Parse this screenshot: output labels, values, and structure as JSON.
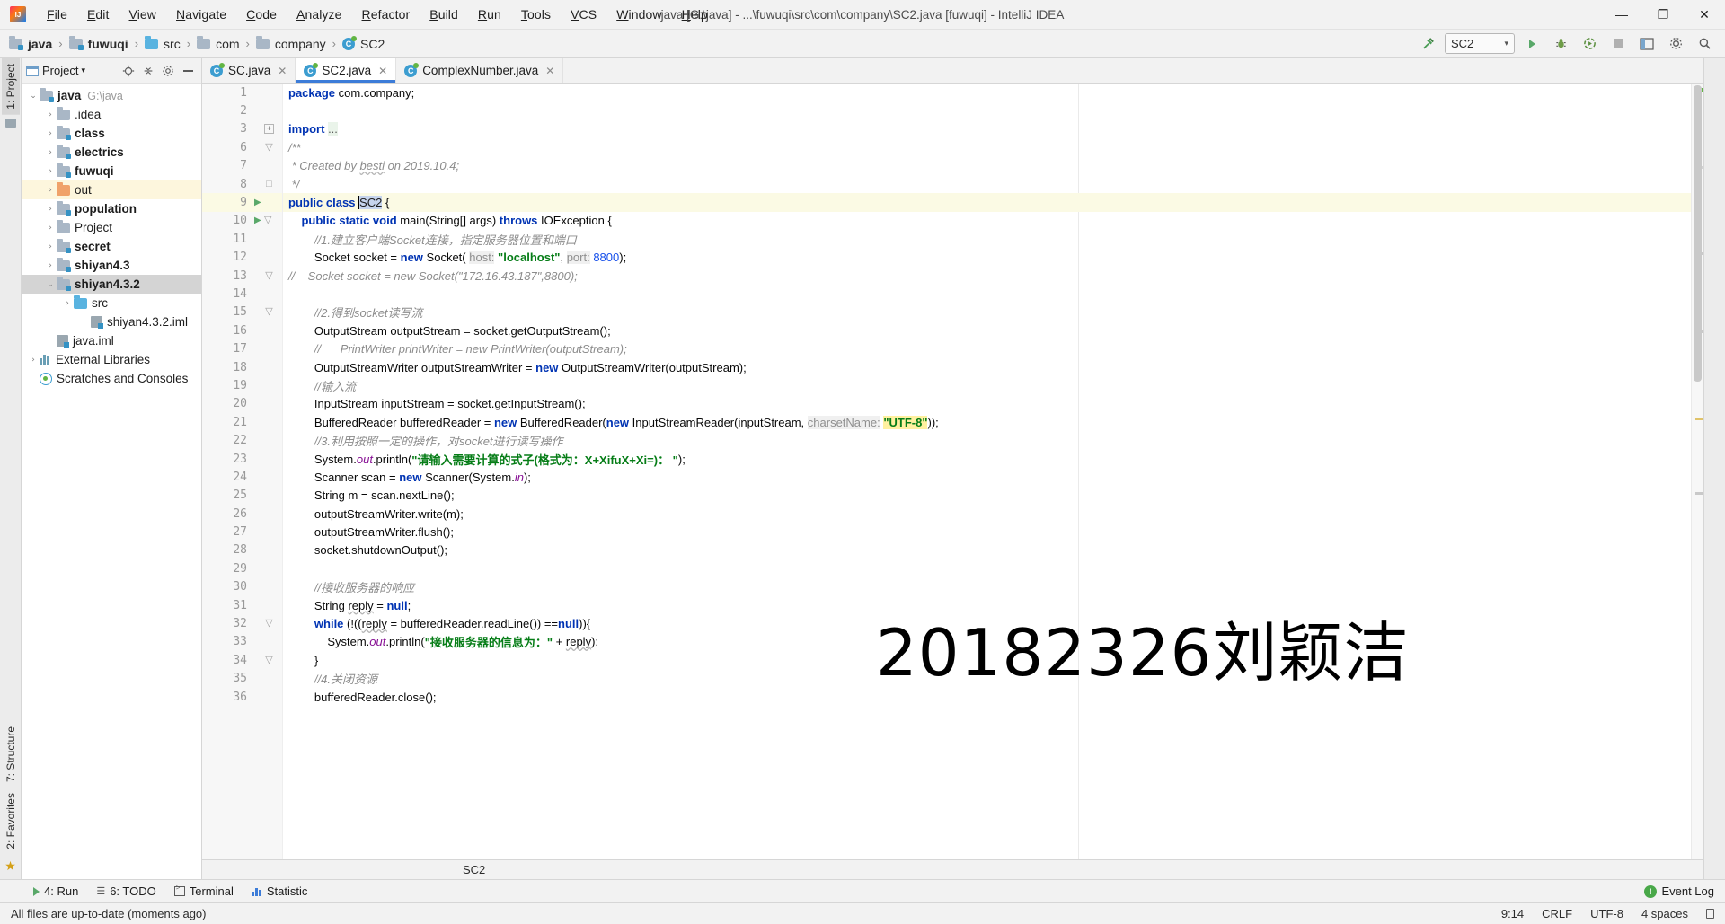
{
  "window": {
    "title": "java [G:\\java] - ...\\fuwuqi\\src\\com\\company\\SC2.java [fuwuqi] - IntelliJ IDEA",
    "minimize": "—",
    "maximize": "❐",
    "close": "✕"
  },
  "menu": {
    "items": [
      "File",
      "Edit",
      "View",
      "Navigate",
      "Code",
      "Analyze",
      "Refactor",
      "Build",
      "Run",
      "Tools",
      "VCS",
      "Window",
      "Help"
    ]
  },
  "breadcrumb": {
    "separator": "›",
    "items": [
      {
        "label": "java",
        "icon": "folder-module-icon",
        "bold": true
      },
      {
        "label": "fuwuqi",
        "icon": "folder-module-icon",
        "bold": true
      },
      {
        "label": "src",
        "icon": "folder-source-icon",
        "bold": false
      },
      {
        "label": "com",
        "icon": "folder-package-icon",
        "bold": false
      },
      {
        "label": "company",
        "icon": "folder-package-icon",
        "bold": false
      },
      {
        "label": "SC2",
        "icon": "java-class-icon",
        "bold": false
      }
    ]
  },
  "toolbar": {
    "build_icon": "hammer-icon",
    "run_config": "SC2",
    "run_config_caret": "▾",
    "run_icon": "▶",
    "debug_icon": "bug-icon",
    "coverage_icon": "run-coverage-icon",
    "stop_icon": "■",
    "layout_icon": "ide-layout-icon",
    "settings_icon": "⚙",
    "search_icon": "⚲"
  },
  "project_panel": {
    "title": "Project",
    "title_caret": "▾",
    "actions": [
      {
        "name": "locate-icon",
        "glyph": "⊕"
      },
      {
        "name": "collapse-all-icon",
        "glyph": "≃"
      },
      {
        "name": "settings-gear-icon",
        "glyph": "⚙"
      },
      {
        "name": "hide-panel-icon",
        "glyph": "—"
      }
    ],
    "tree": [
      {
        "label": "java",
        "sub": "G:\\java",
        "indent": 0,
        "twisty": "⌄",
        "icon": "folder-module-icon",
        "bold": true,
        "state": "expanded"
      },
      {
        "label": ".idea",
        "sub": "",
        "indent": 1,
        "twisty": "›",
        "icon": "folder-plain-icon",
        "bold": false,
        "state": "collapsed"
      },
      {
        "label": "class",
        "sub": "",
        "indent": 1,
        "twisty": "›",
        "icon": "folder-module-icon",
        "bold": true,
        "state": "collapsed"
      },
      {
        "label": "electrics",
        "sub": "",
        "indent": 1,
        "twisty": "›",
        "icon": "folder-module-icon",
        "bold": true,
        "state": "collapsed"
      },
      {
        "label": "fuwuqi",
        "sub": "",
        "indent": 1,
        "twisty": "›",
        "icon": "folder-module-icon",
        "bold": true,
        "state": "collapsed"
      },
      {
        "label": "out",
        "sub": "",
        "indent": 1,
        "twisty": "›",
        "icon": "folder-excluded-icon",
        "bold": false,
        "state": "collapsed",
        "row": "highlight"
      },
      {
        "label": "population",
        "sub": "",
        "indent": 1,
        "twisty": "›",
        "icon": "folder-module-icon",
        "bold": true,
        "state": "collapsed"
      },
      {
        "label": "Project",
        "sub": "",
        "indent": 1,
        "twisty": "›",
        "icon": "folder-plain-icon",
        "bold": false,
        "state": "collapsed"
      },
      {
        "label": "secret",
        "sub": "",
        "indent": 1,
        "twisty": "›",
        "icon": "folder-module-icon",
        "bold": true,
        "state": "collapsed"
      },
      {
        "label": "shiyan4.3",
        "sub": "",
        "indent": 1,
        "twisty": "›",
        "icon": "folder-module-icon",
        "bold": true,
        "state": "collapsed"
      },
      {
        "label": "shiyan4.3.2",
        "sub": "",
        "indent": 1,
        "twisty": "⌄",
        "icon": "folder-module-icon",
        "bold": true,
        "state": "expanded",
        "row": "selected"
      },
      {
        "label": "src",
        "sub": "",
        "indent": 2,
        "twisty": "›",
        "icon": "folder-source-icon",
        "bold": false,
        "state": "collapsed"
      },
      {
        "label": "shiyan4.3.2.iml",
        "sub": "",
        "indent": 3,
        "twisty": "",
        "icon": "iml-file-icon",
        "bold": false,
        "state": "leaf"
      },
      {
        "label": "java.iml",
        "sub": "",
        "indent": 1,
        "twisty": "",
        "icon": "iml-file-icon",
        "bold": false,
        "state": "leaf"
      },
      {
        "label": "External Libraries",
        "sub": "",
        "indent": 0,
        "twisty": "›",
        "icon": "libraries-icon",
        "bold": false,
        "state": "collapsed"
      },
      {
        "label": "Scratches and Consoles",
        "sub": "",
        "indent": 0,
        "twisty": "",
        "icon": "scratches-icon",
        "bold": false,
        "state": "leaf"
      }
    ]
  },
  "left_rail": {
    "tabs": [
      {
        "label": "1: Project",
        "active": true
      },
      {
        "label": "7: Structure",
        "active": false
      },
      {
        "label": "2: Favorites",
        "active": false
      }
    ]
  },
  "editor_tabs": [
    {
      "label": "SC.java",
      "icon": "java-class-icon",
      "active": false,
      "close": "✕"
    },
    {
      "label": "SC2.java",
      "icon": "java-class-icon",
      "active": true,
      "close": "✕"
    },
    {
      "label": "ComplexNumber.java",
      "icon": "java-class-icon",
      "active": false,
      "close": "✕"
    }
  ],
  "editor": {
    "watermark": "20182326刘颖洁",
    "caret_line": 9,
    "lines": [
      {
        "num": "1",
        "runmark": false,
        "fold": "",
        "tokens": [
          {
            "t": "package ",
            "c": "kw"
          },
          {
            "t": "com.company;",
            "c": "txt"
          }
        ]
      },
      {
        "num": "2",
        "runmark": false,
        "fold": "",
        "tokens": []
      },
      {
        "num": "3",
        "runmark": false,
        "fold": "plus",
        "tokens": [
          {
            "t": "import ",
            "c": "kw"
          },
          {
            "t": "...",
            "c": "fold-imports"
          }
        ]
      },
      {
        "num": "6",
        "runmark": false,
        "fold": "minus",
        "tokens": [
          {
            "t": "/**",
            "c": "cmt"
          }
        ]
      },
      {
        "num": "7",
        "runmark": false,
        "fold": "",
        "tokens": [
          {
            "t": " * Created by ",
            "c": "cmt"
          },
          {
            "t": "besti",
            "c": "cmt-ul"
          },
          {
            "t": " on 2019.10.4;",
            "c": "cmt"
          }
        ]
      },
      {
        "num": "8",
        "runmark": false,
        "fold": "end",
        "tokens": [
          {
            "t": " */",
            "c": "cmt"
          }
        ]
      },
      {
        "num": "9",
        "runmark": true,
        "fold": "",
        "tokens": [
          {
            "t": "public class ",
            "c": "kw"
          },
          {
            "t": "|",
            "c": "caret"
          },
          {
            "t": "SC2",
            "c": "sel"
          },
          {
            "t": " {",
            "c": "txt"
          }
        ]
      },
      {
        "num": "10",
        "runmark": true,
        "fold": "minus",
        "tokens": [
          {
            "t": "    ",
            "c": "txt"
          },
          {
            "t": "public static void ",
            "c": "kw"
          },
          {
            "t": "main(String[] args) ",
            "c": "txt"
          },
          {
            "t": "throws ",
            "c": "kw"
          },
          {
            "t": "IOException {",
            "c": "txt"
          }
        ]
      },
      {
        "num": "11",
        "runmark": false,
        "fold": "",
        "tokens": [
          {
            "t": "        //1.建立客户端Socket连接，指定服务器位置和端口",
            "c": "cmt"
          }
        ]
      },
      {
        "num": "12",
        "runmark": false,
        "fold": "",
        "tokens": [
          {
            "t": "        Socket socket = ",
            "c": "txt"
          },
          {
            "t": "new ",
            "c": "kw"
          },
          {
            "t": "Socket( ",
            "c": "txt"
          },
          {
            "t": "host:",
            "c": "hint"
          },
          {
            "t": " ",
            "c": "txt"
          },
          {
            "t": "\"localhost\"",
            "c": "str"
          },
          {
            "t": ", ",
            "c": "txt"
          },
          {
            "t": "port:",
            "c": "hint"
          },
          {
            "t": " ",
            "c": "txt"
          },
          {
            "t": "8800",
            "c": "num"
          },
          {
            "t": ");",
            "c": "txt"
          }
        ]
      },
      {
        "num": "13",
        "runmark": false,
        "fold": "minus",
        "tokens": [
          {
            "t": "//    Socket socket = new Socket(\"172.16.43.187\",8800);",
            "c": "cmt"
          }
        ]
      },
      {
        "num": "14",
        "runmark": false,
        "fold": "",
        "tokens": []
      },
      {
        "num": "15",
        "runmark": false,
        "fold": "minus",
        "tokens": [
          {
            "t": "        //2.得到socket读写流",
            "c": "cmt"
          }
        ]
      },
      {
        "num": "16",
        "runmark": false,
        "fold": "",
        "tokens": [
          {
            "t": "        OutputStream outputStream = socket.getOutputStream();",
            "c": "txt"
          }
        ]
      },
      {
        "num": "17",
        "runmark": false,
        "fold": "",
        "tokens": [
          {
            "t": "        //      PrintWriter printWriter = new PrintWriter(outputStream);",
            "c": "cmt"
          }
        ]
      },
      {
        "num": "18",
        "runmark": false,
        "fold": "",
        "tokens": [
          {
            "t": "        OutputStreamWriter outputStreamWriter = ",
            "c": "txt"
          },
          {
            "t": "new ",
            "c": "kw"
          },
          {
            "t": "OutputStreamWriter(outputStream);",
            "c": "txt"
          }
        ]
      },
      {
        "num": "19",
        "runmark": false,
        "fold": "",
        "tokens": [
          {
            "t": "        //输入流",
            "c": "cmt"
          }
        ]
      },
      {
        "num": "20",
        "runmark": false,
        "fold": "",
        "tokens": [
          {
            "t": "        InputStream inputStream = socket.getInputStream();",
            "c": "txt"
          }
        ]
      },
      {
        "num": "21",
        "runmark": false,
        "fold": "",
        "tokens": [
          {
            "t": "        BufferedReader bufferedReader = ",
            "c": "txt"
          },
          {
            "t": "new ",
            "c": "kw"
          },
          {
            "t": "BufferedReader(",
            "c": "txt"
          },
          {
            "t": "new ",
            "c": "kw"
          },
          {
            "t": "InputStreamReader(inputStream, ",
            "c": "txt"
          },
          {
            "t": "charsetName:",
            "c": "hint"
          },
          {
            "t": " ",
            "c": "txt"
          },
          {
            "t": "\"UTF-8\"",
            "c": "hl-str"
          },
          {
            "t": "));",
            "c": "txt"
          }
        ]
      },
      {
        "num": "22",
        "runmark": false,
        "fold": "",
        "tokens": [
          {
            "t": "        //3.利用按照一定的操作，对socket进行读写操作",
            "c": "cmt"
          }
        ]
      },
      {
        "num": "23",
        "runmark": false,
        "fold": "",
        "tokens": [
          {
            "t": "        System.",
            "c": "txt"
          },
          {
            "t": "out",
            "c": "field"
          },
          {
            "t": ".println(",
            "c": "txt"
          },
          {
            "t": "\"请输入需要计算的式子(格式为：X+XifuX+Xi=)： \"",
            "c": "str"
          },
          {
            "t": ");",
            "c": "txt"
          }
        ]
      },
      {
        "num": "24",
        "runmark": false,
        "fold": "",
        "tokens": [
          {
            "t": "        Scanner scan = ",
            "c": "txt"
          },
          {
            "t": "new ",
            "c": "kw"
          },
          {
            "t": "Scanner(System.",
            "c": "txt"
          },
          {
            "t": "in",
            "c": "field"
          },
          {
            "t": ");",
            "c": "txt"
          }
        ]
      },
      {
        "num": "25",
        "runmark": false,
        "fold": "",
        "tokens": [
          {
            "t": "        String m = scan.nextLine();",
            "c": "txt"
          }
        ]
      },
      {
        "num": "26",
        "runmark": false,
        "fold": "",
        "tokens": [
          {
            "t": "        outputStreamWriter.write(m);",
            "c": "txt"
          }
        ]
      },
      {
        "num": "27",
        "runmark": false,
        "fold": "",
        "tokens": [
          {
            "t": "        outputStreamWriter.flush();",
            "c": "txt"
          }
        ]
      },
      {
        "num": "28",
        "runmark": false,
        "fold": "",
        "tokens": [
          {
            "t": "        socket.shutdownOutput();",
            "c": "txt"
          }
        ]
      },
      {
        "num": "29",
        "runmark": false,
        "fold": "",
        "tokens": []
      },
      {
        "num": "30",
        "runmark": false,
        "fold": "",
        "tokens": [
          {
            "t": "        //接收服务器的响应",
            "c": "cmt"
          }
        ]
      },
      {
        "num": "31",
        "runmark": false,
        "fold": "",
        "tokens": [
          {
            "t": "        String ",
            "c": "txt"
          },
          {
            "t": "reply",
            "c": "txt-ul"
          },
          {
            "t": " = ",
            "c": "txt"
          },
          {
            "t": "null",
            "c": "kw"
          },
          {
            "t": ";",
            "c": "txt"
          }
        ]
      },
      {
        "num": "32",
        "runmark": false,
        "fold": "minus",
        "tokens": [
          {
            "t": "        ",
            "c": "txt"
          },
          {
            "t": "while ",
            "c": "kw"
          },
          {
            "t": "(!((",
            "c": "txt"
          },
          {
            "t": "reply",
            "c": "txt-ul"
          },
          {
            "t": " = bufferedReader.readLine()) ==",
            "c": "txt"
          },
          {
            "t": "null",
            "c": "kw"
          },
          {
            "t": ")){",
            "c": "txt"
          }
        ]
      },
      {
        "num": "33",
        "runmark": false,
        "fold": "",
        "tokens": [
          {
            "t": "            System.",
            "c": "txt"
          },
          {
            "t": "out",
            "c": "field"
          },
          {
            "t": ".println(",
            "c": "txt"
          },
          {
            "t": "\"接收服务器的信息为：\"",
            "c": "str"
          },
          {
            "t": " + ",
            "c": "txt"
          },
          {
            "t": "reply",
            "c": "txt-ul"
          },
          {
            "t": ");",
            "c": "txt"
          }
        ]
      },
      {
        "num": "34",
        "runmark": false,
        "fold": "minus",
        "tokens": [
          {
            "t": "        }",
            "c": "txt"
          }
        ]
      },
      {
        "num": "35",
        "runmark": false,
        "fold": "",
        "tokens": [
          {
            "t": "        //4.关闭资源",
            "c": "cmt"
          }
        ]
      },
      {
        "num": "36",
        "runmark": false,
        "fold": "",
        "tokens": [
          {
            "t": "        bufferedReader.close();",
            "c": "txt"
          }
        ]
      }
    ]
  },
  "status_breadcrumb": "SC2",
  "toolwindow_bar": {
    "buttons": [
      {
        "label": "4: Run",
        "icon": "run-icon",
        "underline": "4"
      },
      {
        "label": "6: TODO",
        "icon": "todo-icon",
        "underline": "6"
      },
      {
        "label": "Terminal",
        "icon": "terminal-icon",
        "underline": ""
      },
      {
        "label": "Statistic",
        "icon": "statistic-icon",
        "underline": ""
      }
    ],
    "event_log": {
      "label": "Event Log",
      "icon": "event-log-icon"
    }
  },
  "statusbar": {
    "message": "All files are up-to-date (moments ago)",
    "position": "9:14",
    "line_ending": "CRLF",
    "encoding": "UTF-8",
    "indent": "4 spaces",
    "lock_icon": "read-write-lock-icon"
  }
}
